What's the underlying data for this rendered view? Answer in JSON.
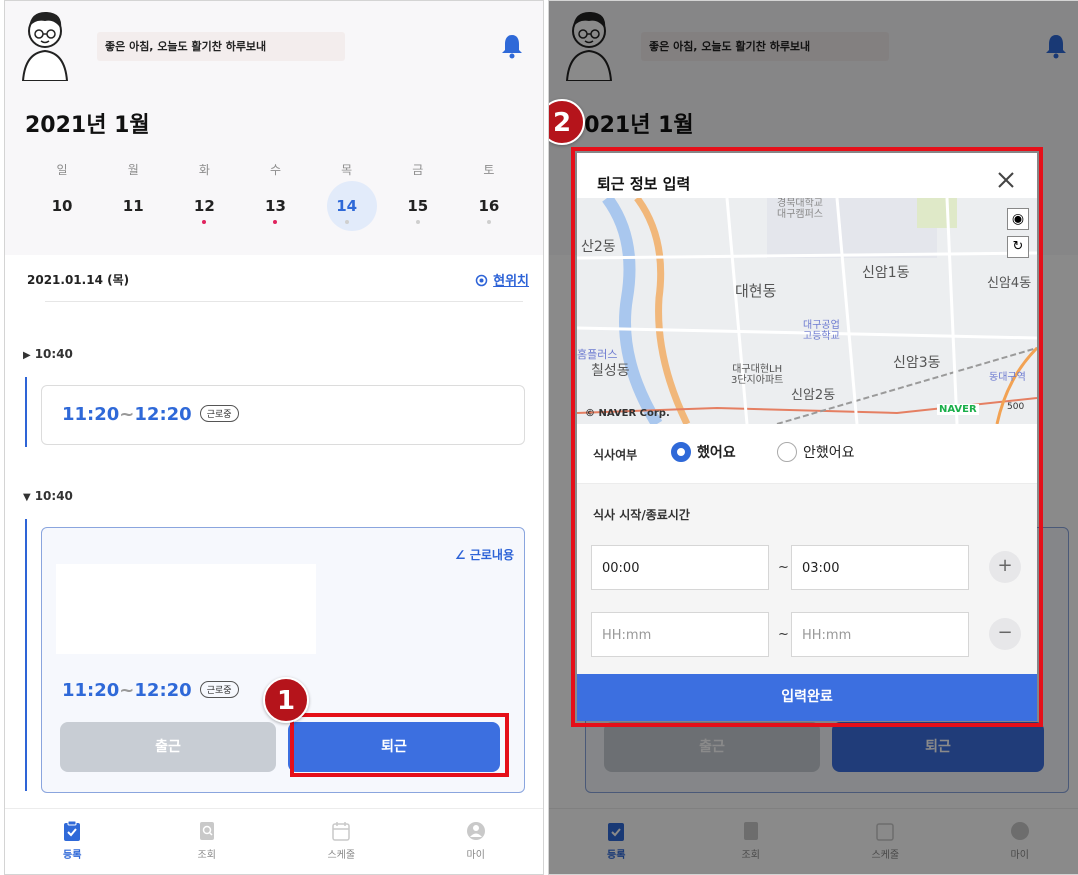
{
  "greeting": "좋은 아침, 오늘도 활기찬 하루보내",
  "month_title": "2021년 1월",
  "weekdays": [
    "일",
    "월",
    "화",
    "수",
    "목",
    "금",
    "토"
  ],
  "dates": [
    "10",
    "11",
    "12",
    "13",
    "14",
    "15",
    "16"
  ],
  "selected_date": "14",
  "date_label": "2021.01.14 (목)",
  "location_link": "현위치",
  "entries": [
    {
      "time": "10:40",
      "range_start": "11:20",
      "range_sep": "~",
      "range_end": "12:20",
      "status": "근로중",
      "collapsed": true
    },
    {
      "time": "10:40",
      "range_start": "11:20",
      "range_sep": "~",
      "range_end": "12:20",
      "status": "근로중",
      "collapsed": false,
      "work_link": "근로내용"
    }
  ],
  "buttons": {
    "clock_in": "출근",
    "clock_out": "퇴근"
  },
  "nav": [
    {
      "label": "등록",
      "icon": "clipboard-check-icon",
      "active": true
    },
    {
      "label": "조회",
      "icon": "search-document-icon",
      "active": false
    },
    {
      "label": "스케줄",
      "icon": "calendar-icon",
      "active": false
    },
    {
      "label": "마이",
      "icon": "person-icon",
      "active": false
    }
  ],
  "steps": {
    "one": "1",
    "two": "2"
  },
  "modal": {
    "title": "퇴근 정보 입력",
    "map": {
      "labels": [
        "경북대학교\n대구캠퍼스",
        "산2동",
        "신암1동",
        "신암4동",
        "대현동",
        "대구공업\n고등학교",
        "홈플러스",
        "칠성동",
        "대구대현LH\n3단지아파트",
        "신암2동",
        "신암3동",
        "동대구역"
      ],
      "attribution": "© NAVER Corp.",
      "brand": "NAVER",
      "scale": "500"
    },
    "meal_label": "식사여부",
    "meal_yes": "했어요",
    "meal_no": "안했어요",
    "meal_selected": "yes",
    "time_label": "식사 시작/종료시간",
    "rows": [
      {
        "start": "00:00",
        "end": "03:00",
        "action": "+"
      },
      {
        "start_placeholder": "HH:mm",
        "end_placeholder": "HH:mm",
        "action": "−"
      }
    ],
    "tilde": "~",
    "submit": "입력완료"
  },
  "colors": {
    "accent": "#3c6fe0",
    "selected_date_bg": "#e2ebfa",
    "step_marker": "#b5141b",
    "highlight_frame": "#e50f19",
    "dot_red": "#e0245e"
  }
}
